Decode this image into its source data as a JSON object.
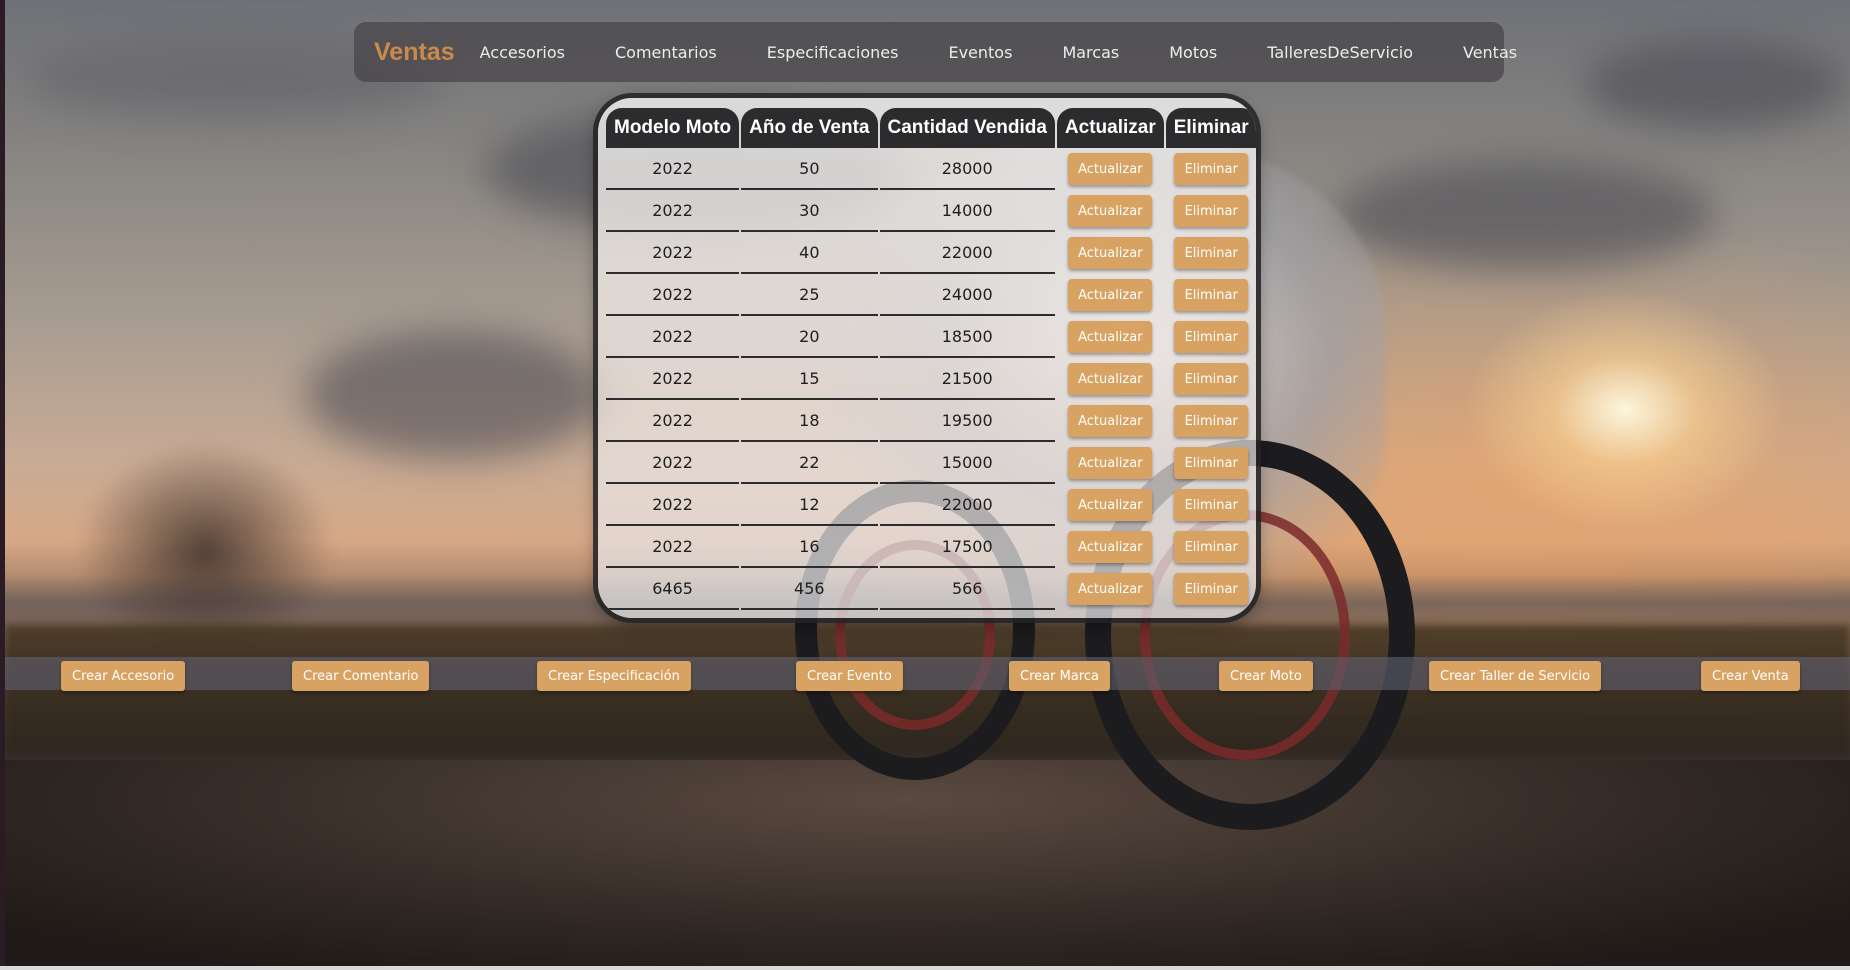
{
  "nav": {
    "brand": "Ventas",
    "links": [
      "Accesorios",
      "Comentarios",
      "Especificaciones",
      "Eventos",
      "Marcas",
      "Motos",
      "TalleresDeServicio",
      "Ventas"
    ]
  },
  "table": {
    "headers": [
      "Modelo Moto",
      "Año de Venta",
      "Cantidad Vendida",
      "Actualizar",
      "Eliminar"
    ],
    "update_label": "Actualizar",
    "delete_label": "Eliminar",
    "rows": [
      [
        "2022",
        "50",
        "28000"
      ],
      [
        "2022",
        "30",
        "14000"
      ],
      [
        "2022",
        "40",
        "22000"
      ],
      [
        "2022",
        "25",
        "24000"
      ],
      [
        "2022",
        "20",
        "18500"
      ],
      [
        "2022",
        "15",
        "21500"
      ],
      [
        "2022",
        "18",
        "19500"
      ],
      [
        "2022",
        "22",
        "15000"
      ],
      [
        "2022",
        "12",
        "22000"
      ],
      [
        "2022",
        "16",
        "17500"
      ],
      [
        "6465",
        "456",
        "566"
      ]
    ]
  },
  "create_buttons": [
    "Crear Accesorio",
    "Crear Comentario",
    "Crear Especificación",
    "Crear Evento",
    "Crear Marca",
    "Crear Moto",
    "Crear Taller de Servicio",
    "Crear Venta"
  ],
  "colors": {
    "accent": "#d8a262",
    "brand": "#c98a4b",
    "header_bg": "#2c2b2e",
    "nav_bg": "#464446"
  }
}
